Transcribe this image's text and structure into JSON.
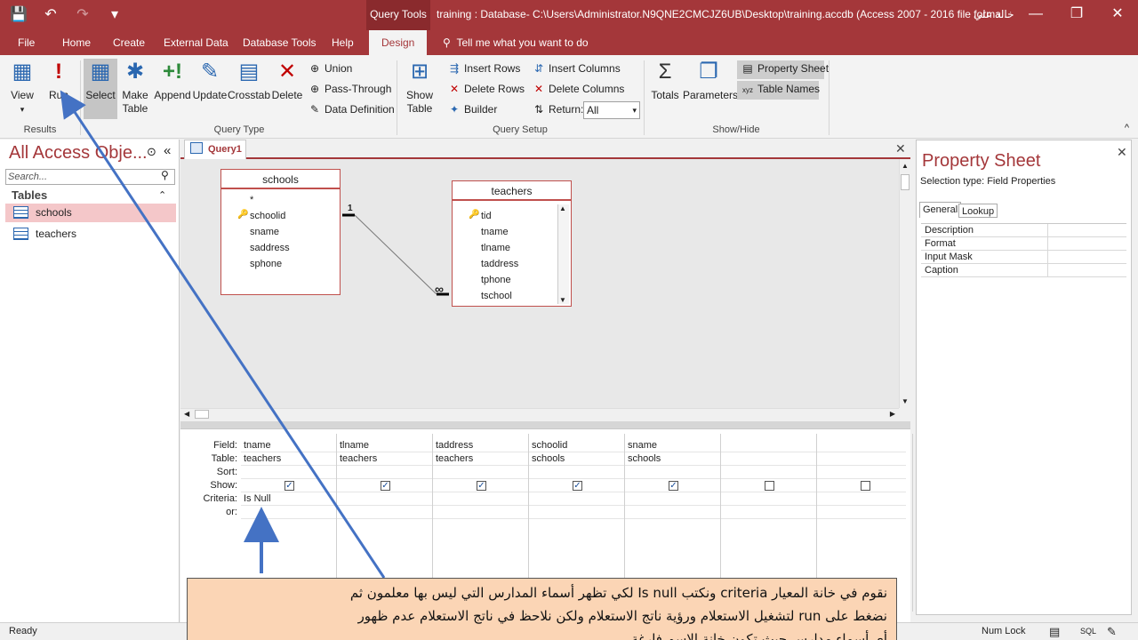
{
  "titlebar": {
    "context_tab": "Query Tools",
    "window_title": "training : Database- C:\\Users\\Administrator.N9QNE2CMCJZ6UB\\Desktop\\training.accdb (Access 2007 - 2016 file forma...",
    "user": "خالد علي",
    "save_icon": "💾",
    "undo_icon": "↶",
    "redo_icon": "↷",
    "customize_icon": "▾",
    "minimize": "—",
    "restore": "❐",
    "close": "✕"
  },
  "menu": {
    "file": "File",
    "home": "Home",
    "create": "Create",
    "external": "External Data",
    "dbtools": "Database Tools",
    "help": "Help",
    "design": "Design",
    "tellme": "Tell me what you want to do",
    "tellme_icon": "⚲"
  },
  "ribbon": {
    "view": "View",
    "view_icon": "▦",
    "view_arrow": "▾",
    "run": "Run",
    "run_icon": "!",
    "select": "Select",
    "select_icon": "▦",
    "maketable": "Make Table",
    "maketable_icon": "✱",
    "append": "Append",
    "append_icon": "+!",
    "update": "Update",
    "update_icon": "✎",
    "crosstab": "Crosstab",
    "crosstab_icon": "▤",
    "delete": "Delete",
    "delete_icon": "✕",
    "union": "Union",
    "union_icon": "⊕",
    "passthrough": "Pass-Through",
    "passthrough_icon": "⊕",
    "datadef": "Data Definition",
    "datadef_icon": "✎",
    "showtable": "Show Table",
    "showtable_icon": "⊞",
    "insertrows": "Insert Rows",
    "insertrows_icon": "⇶",
    "deleterows": "Delete Rows",
    "deleterows_icon": "✕",
    "builder": "Builder",
    "builder_icon": "✦",
    "insertcols": "Insert Columns",
    "insertcols_icon": "⇵",
    "deletecols": "Delete Columns",
    "deletecols_icon": "✕",
    "return_label": "Return:",
    "return_icon": "⇅",
    "return_value": "All",
    "return_arrow": "▾",
    "totals": "Totals",
    "totals_icon": "Σ",
    "parameters": "Parameters",
    "parameters_icon": "❐",
    "propsheet": "Property Sheet",
    "propsheet_icon": "▤",
    "tablenames": "Table Names",
    "tablenames_icon": "xyz",
    "group_results": "Results",
    "group_querytype": "Query Type",
    "group_querysetup": "Query Setup",
    "group_showhide": "Show/Hide",
    "collapse": "^"
  },
  "nav": {
    "title": "All Access Obje...",
    "chev": "⊙",
    "collapse": "«",
    "search_placeholder": "Search...",
    "search_icon": "⚲",
    "section": "Tables",
    "section_icon": "⌃",
    "items": [
      "schools",
      "teachers"
    ]
  },
  "query": {
    "tab": "Query1",
    "close": "✕",
    "schools": {
      "title": "schools",
      "fields": [
        "*",
        "schoolid",
        "sname",
        "saddress",
        "sphone"
      ]
    },
    "teachers": {
      "title": "teachers",
      "fields": [
        "tid",
        "tname",
        "tlname",
        "taddress",
        "tphone",
        "tschool"
      ]
    },
    "rel_one": "1",
    "rel_many": "∞",
    "up": "▲",
    "down": "▼",
    "left": "◀",
    "right": "▶"
  },
  "grid": {
    "labels": {
      "field": "Field:",
      "table": "Table:",
      "sort": "Sort:",
      "show": "Show:",
      "criteria": "Criteria:",
      "or": "or:"
    },
    "check": "✓",
    "columns": [
      {
        "field": "tname",
        "table": "teachers",
        "criteria": "Is Null"
      },
      {
        "field": "tlname",
        "table": "teachers",
        "criteria": ""
      },
      {
        "field": "taddress",
        "table": "teachers",
        "criteria": ""
      },
      {
        "field": "schoolid",
        "table": "schools",
        "criteria": ""
      },
      {
        "field": "sname",
        "table": "schools",
        "criteria": ""
      },
      {
        "field": "",
        "table": "",
        "criteria": ""
      },
      {
        "field": "",
        "table": "",
        "criteria": ""
      }
    ]
  },
  "propsheet": {
    "title": "Property Sheet",
    "close": "✕",
    "selection": "Selection type:  Field Properties",
    "tab_general": "General",
    "tab_lookup": "Lookup",
    "rows": [
      "Description",
      "Format",
      "Input Mask",
      "Caption"
    ]
  },
  "status": {
    "ready": "Ready",
    "numlock": "Num Lock",
    "view1": "▤",
    "view2": "SQL",
    "view3": "✎"
  },
  "annotation": {
    "line1": "نقوم في خانة المعيار criteria ونكتب Is null لكي تظهر أسماء المدارس التي ليس بها معلمون ثم",
    "line2": "نضغط على run لتشغيل الاستعلام ورؤية ناتج الاستعلام ولكن نلاحظ في ناتج الاستعلام عدم ظهور",
    "line3": "أي أسماء مدارس حيث تكون خانة الاسم فارغة",
    "color": "#fbd5b5",
    "arrow_color": "#4472c4"
  }
}
